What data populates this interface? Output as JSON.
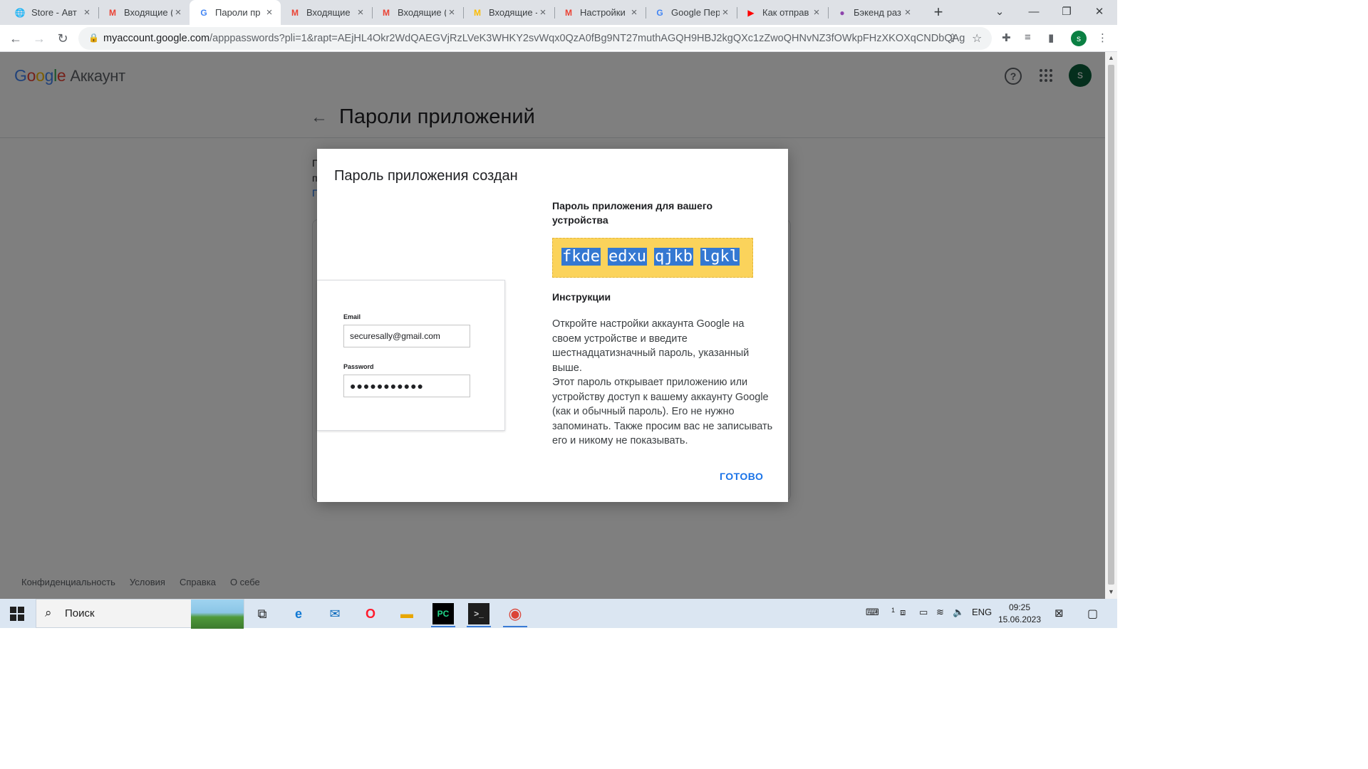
{
  "browser": {
    "tabs": [
      {
        "title": "Store - Авт",
        "icon": "globe-icon"
      },
      {
        "title": "Входящие (",
        "icon": "gmail-icon"
      },
      {
        "title": "Пароли пр",
        "icon": "google-icon",
        "active": true
      },
      {
        "title": "Входящие",
        "icon": "gmail-icon"
      },
      {
        "title": "Входящие (",
        "icon": "gmail-icon"
      },
      {
        "title": "Входящие -",
        "icon": "gmail-icon"
      },
      {
        "title": "Настройки",
        "icon": "gmail-icon"
      },
      {
        "title": "Google Пер",
        "icon": "translate-icon"
      },
      {
        "title": "Как отправ",
        "icon": "youtube-icon"
      },
      {
        "title": "Бэкенд раз",
        "icon": "course-icon"
      }
    ],
    "url_host": "myaccount.google.com",
    "url_path": "/apppasswords?pli=1&rapt=AEjHL4Okr2WdQAEGVjRzLVeK3WHKY2svWqx0QzA0fBg9NT27muthAGQH9HBJ2kgQXc1zZwoQHNvNZ3fOWkpFHzXKOXqCNDbQAg",
    "profile_initial": "s"
  },
  "header": {
    "logo": [
      "G",
      "o",
      "o",
      "g",
      "l",
      "e"
    ],
    "product": "Аккаунт",
    "avatar_initial": "s"
  },
  "page": {
    "title": "Пароли приложений",
    "bg_line1": "П",
    "bg_line2": "п",
    "bg_line3": "П"
  },
  "dialog": {
    "title": "Пароль приложения создан",
    "illustration": {
      "email_label": "Email",
      "email_value": "securesally@gmail.com",
      "password_label": "Password",
      "password_value": "●●●●●●●●●●●"
    },
    "subtitle": "Пароль приложения для вашего устройства",
    "password_chunks": [
      "fkde",
      "edxu",
      "qjkb",
      "lgkl"
    ],
    "instructions_heading": "Инструкции",
    "instructions_p1": "Откройте настройки аккаунта Google на своем устройстве и введите шестнадцатизначный пароль, указанный выше.",
    "instructions_p2": "Этот пароль открывает приложению или устройству доступ к вашему аккаунту Google (как и обычный пароль). Его не нужно запоминать. Также просим вас не записывать его и никому не показывать.",
    "done_label": "ГОТОВО"
  },
  "footer": {
    "links": [
      "Конфиденциальность",
      "Условия",
      "Справка",
      "О себе"
    ]
  },
  "taskbar": {
    "search_placeholder": "Поиск",
    "lang": "ENG",
    "time": "09:25",
    "date": "15.06.2023",
    "notif_count": "1"
  },
  "colors": {
    "password_highlight": "#3478d2",
    "password_box": "#fbd35b",
    "accent": "#1a73e8"
  }
}
